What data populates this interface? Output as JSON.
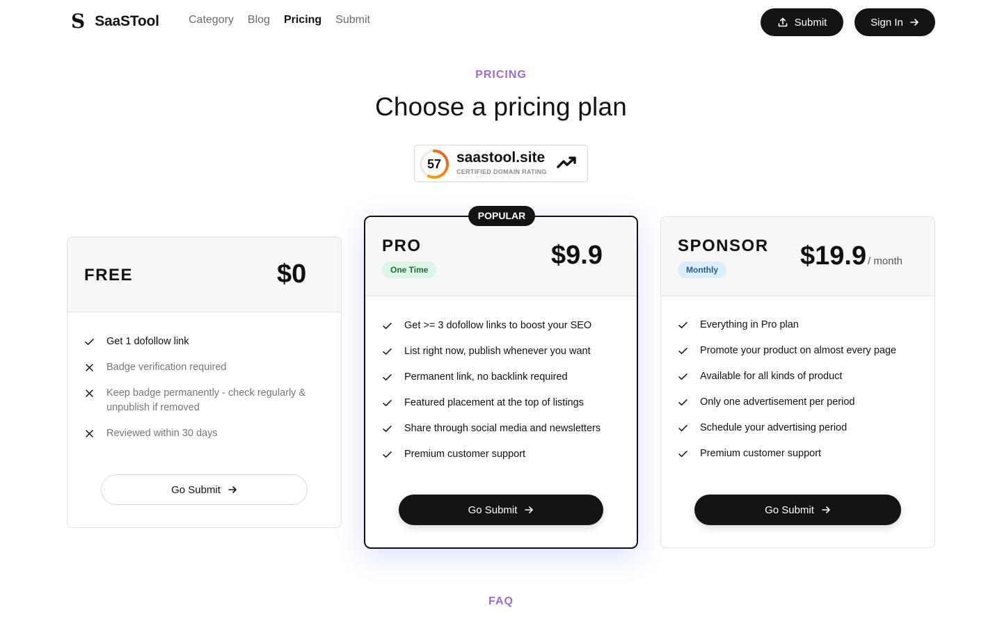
{
  "header": {
    "logo_mark": "S",
    "logo_text": "SaaSTool",
    "nav": [
      {
        "label": "Category",
        "active": false
      },
      {
        "label": "Blog",
        "active": false
      },
      {
        "label": "Pricing",
        "active": true
      },
      {
        "label": "Submit",
        "active": false
      }
    ],
    "submit_label": "Submit",
    "signin_label": "Sign In"
  },
  "hero": {
    "eyebrow": "PRICING",
    "title": "Choose a pricing plan"
  },
  "badge": {
    "score": "57",
    "domain": "saastool.site",
    "subtitle": "CERTIFIED DOMAIN RATING"
  },
  "plans": {
    "free": {
      "name": "FREE",
      "price": "$0",
      "features": [
        {
          "text": "Get 1 dofollow link",
          "included": true
        },
        {
          "text": "Badge verification required",
          "included": false
        },
        {
          "text": "Keep badge permanently - check regularly & unpublish if removed",
          "included": false
        },
        {
          "text": "Reviewed within 30 days",
          "included": false
        }
      ],
      "cta": "Go Submit"
    },
    "pro": {
      "badge": "POPULAR",
      "name": "PRO",
      "billing": "One Time",
      "price": "$9.9",
      "features": [
        {
          "text": "Get >= 3 dofollow links to boost your SEO",
          "included": true
        },
        {
          "text": "List right now, publish whenever you want",
          "included": true
        },
        {
          "text": "Permanent link, no backlink required",
          "included": true
        },
        {
          "text": "Featured placement at the top of listings",
          "included": true
        },
        {
          "text": "Share through social media and newsletters",
          "included": true
        },
        {
          "text": "Premium customer support",
          "included": true
        }
      ],
      "cta": "Go Submit"
    },
    "sponsor": {
      "name": "SPONSOR",
      "billing": "Monthly",
      "price": "$19.9",
      "period": "/ month",
      "features": [
        {
          "text": "Everything in Pro plan",
          "included": true
        },
        {
          "text": "Promote your product on almost every page",
          "included": true
        },
        {
          "text": "Available for all kinds of product",
          "included": true
        },
        {
          "text": "Only one advertisement per period",
          "included": true
        },
        {
          "text": "Schedule your advertising period",
          "included": true
        },
        {
          "text": "Premium customer support",
          "included": true
        }
      ],
      "cta": "Go Submit"
    }
  },
  "faq": {
    "eyebrow": "FAQ"
  },
  "colors": {
    "accent": "#9b6bdc",
    "dark": "#141414",
    "ring_start": "#f7b500",
    "ring_end": "#f0552a"
  }
}
